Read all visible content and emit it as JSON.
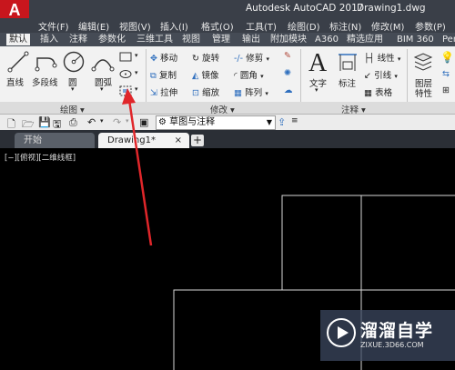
{
  "app": {
    "logo_letter": "A",
    "title": "Autodesk AutoCAD 2017",
    "document": "Drawing1.dwg"
  },
  "menu": [
    "文件(F)",
    "编辑(E)",
    "视图(V)",
    "插入(I)",
    "格式(O)",
    "工具(T)",
    "绘图(D)",
    "标注(N)",
    "修改(M)",
    "参数(P)"
  ],
  "ribbon_tabs": [
    "默认",
    "插入",
    "注释",
    "参数化",
    "三维工具",
    "视图",
    "管理",
    "输出",
    "附加模块",
    "A360",
    "精选应用",
    "BIM 360",
    "Per"
  ],
  "ribbon_active_tab": "默认",
  "draw_panel": {
    "title": "绘图 ▾",
    "tools": [
      "直线",
      "多段线",
      "圆",
      "圆弧"
    ]
  },
  "modify_panel": {
    "title": "修改 ▾",
    "tools": [
      "移动",
      "旋转",
      "修剪",
      "复制",
      "镜像",
      "圆角",
      "拉伸",
      "缩放",
      "阵列"
    ]
  },
  "annotation_panel": {
    "title": "注释 ▾",
    "tools": [
      "文字",
      "标注",
      "线性",
      "引线",
      "表格"
    ]
  },
  "layers_panel": {
    "tools": [
      "图层",
      "特性"
    ]
  },
  "workspace": {
    "value": "草图与注释"
  },
  "file_tabs": {
    "start": "开始",
    "drawing": "Drawing1*",
    "close": "×",
    "add": "+"
  },
  "viewport_label": "[−][俯视][二维线框]",
  "watermark": {
    "brand": "溜溜自学",
    "url": "ZIXUE.3D66.COM"
  },
  "colors": {
    "title_bar": "#3a3f48",
    "ribbon": "#f2f2f2",
    "canvas": "#000000",
    "annotation_arrow": "#e0262a",
    "logo": "#c8161d"
  }
}
